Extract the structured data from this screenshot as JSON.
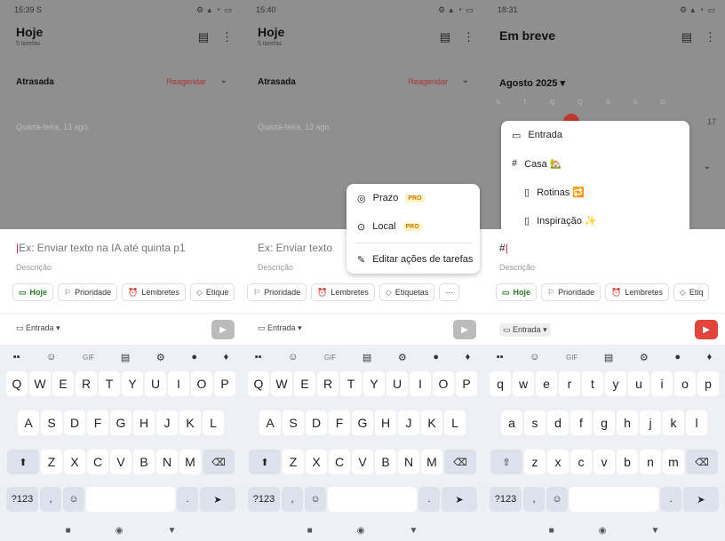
{
  "screens": [
    {
      "status_time": "15:39",
      "status_extra": "S",
      "title": "Hoje",
      "subtitle": "5 tarefas",
      "overdue_label": "Atrasada",
      "reschedule_label": "Reagendar",
      "date_row": "Quarta-feira, 13 ago.",
      "task_placeholder": "Ex: Enviar texto na IA até quinta p1",
      "description": "Descrição",
      "chips": [
        "Hoje",
        "Prioridade",
        "Lembretes",
        "Etique"
      ],
      "project": "Entrada"
    },
    {
      "status_time": "15:40",
      "title": "Hoje",
      "subtitle": "5 tarefas",
      "overdue_label": "Atrasada",
      "reschedule_label": "Reagendar",
      "date_row": "Quarta-feira, 13 ago.",
      "task_placeholder": "Ex: Enviar texto",
      "description": "Descrição",
      "chips": [
        "Prioridade",
        "Lembretes",
        "Etiquetas",
        "···"
      ],
      "project": "Entrada",
      "popup": {
        "items": [
          "Prazo",
          "Local"
        ],
        "pro_badge": "PRO",
        "edit_label": "Editar ações de tarefas"
      }
    },
    {
      "status_time": "18:31",
      "title": "Em breve",
      "month_label": "Agosto 2025",
      "weekdays": [
        "S",
        "T",
        "Q",
        "Q",
        "S",
        "S",
        "D"
      ],
      "day_17": "17",
      "task_input": "#",
      "description": "Descrição",
      "chips": [
        "Hoje",
        "Prioridade",
        "Lembretes",
        "Etiq"
      ],
      "project": "Entrada",
      "popup": {
        "items": [
          "Entrada",
          "Casa 🏡",
          "Rotinas 🔁",
          "Inspiração ✨"
        ]
      }
    }
  ],
  "keyboard": {
    "toolbar": [
      "GIF"
    ],
    "row1_upper": [
      "Q",
      "W",
      "E",
      "R",
      "T",
      "Y",
      "U",
      "I",
      "O",
      "P"
    ],
    "row1_lower": [
      "q",
      "w",
      "e",
      "r",
      "t",
      "y",
      "u",
      "i",
      "o",
      "p"
    ],
    "row2_upper": [
      "A",
      "S",
      "D",
      "F",
      "G",
      "H",
      "J",
      "K",
      "L"
    ],
    "row2_lower": [
      "a",
      "s",
      "d",
      "f",
      "g",
      "h",
      "j",
      "k",
      "l"
    ],
    "row3_upper": [
      "Z",
      "X",
      "C",
      "V",
      "B",
      "N",
      "M"
    ],
    "row3_lower": [
      "z",
      "x",
      "c",
      "v",
      "b",
      "n",
      "m"
    ],
    "symbols_key": "?123",
    "comma_key": ",",
    "period_key": "."
  },
  "colors": {
    "accent_red": "#e0443a",
    "today_green": "#2a7a2a"
  }
}
